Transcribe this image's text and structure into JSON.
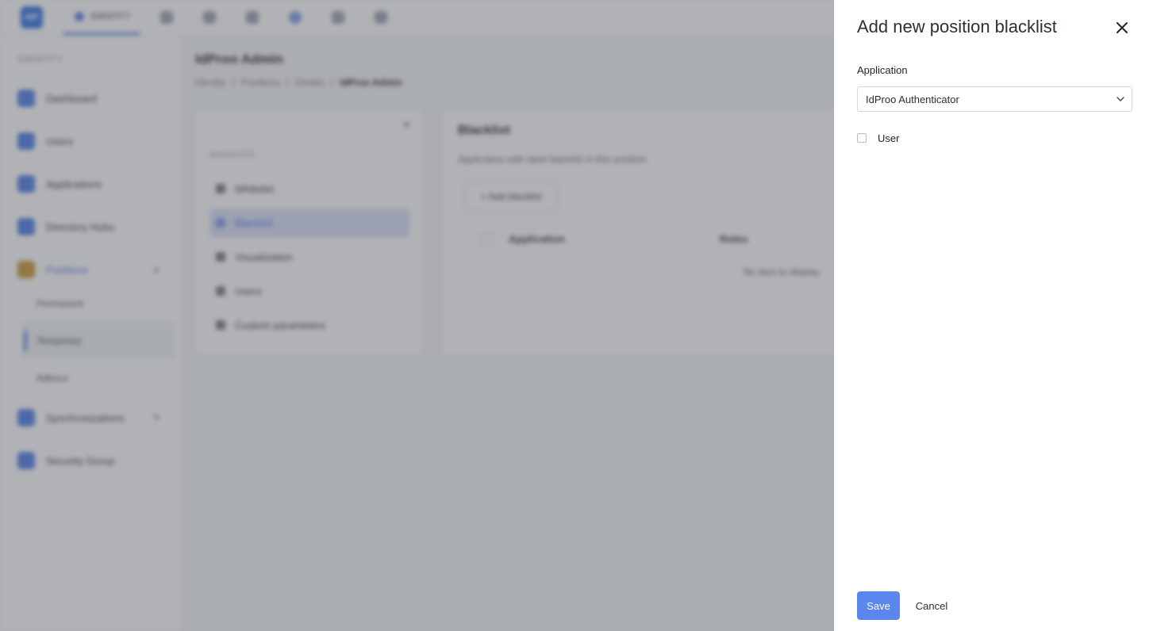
{
  "background": {
    "logo_text": "IdP",
    "top_tab_label": "IDENTITY",
    "sidebar": {
      "caption": "IDENTITY",
      "items": [
        {
          "label": "Dashboard"
        },
        {
          "label": "Users"
        },
        {
          "label": "Applications"
        },
        {
          "label": "Directory Hubs"
        },
        {
          "label": "Positions"
        },
        {
          "label": "Synchronizations"
        },
        {
          "label": "Security Group"
        }
      ],
      "sub_items": [
        {
          "label": "Permanent"
        },
        {
          "label": "Temporary"
        },
        {
          "label": "Adhocs"
        }
      ]
    },
    "page_title": "IdProo Admin",
    "breadcrumb": [
      "Identity",
      "Positions",
      "Details",
      "IdProo Admin"
    ],
    "left_card": {
      "caption": "MANAGER",
      "menu": [
        {
          "label": "Whitelist"
        },
        {
          "label": "Blacklist"
        },
        {
          "label": "Visualization"
        },
        {
          "label": "Users"
        },
        {
          "label": "Custom parameters"
        }
      ]
    },
    "right_card": {
      "title": "Blacklist",
      "description": "Application with label blacklist in this position",
      "add_button": "+ Add blacklist",
      "col_application": "Application",
      "col_roles": "Roles",
      "empty_text": "No item to display"
    }
  },
  "drawer": {
    "title": "Add new position blacklist",
    "application_label": "Application",
    "application_value": "IdProo Authenticator",
    "user_checkbox_label": "User",
    "user_checked": false,
    "save_label": "Save",
    "cancel_label": "Cancel"
  },
  "colors": {
    "primary": "#5b86ee",
    "overlay": "#50545c"
  },
  "icons": {
    "close": "close-icon",
    "select": "chevron-down-icon"
  }
}
